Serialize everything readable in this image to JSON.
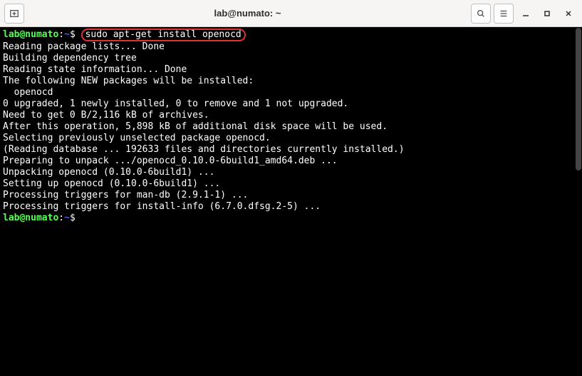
{
  "window": {
    "title": "lab@numato: ~"
  },
  "prompt1": {
    "user": "lab@numato",
    "sep": ":",
    "path": "~",
    "dollar": "$",
    "command": "sudo apt-get install openocd"
  },
  "output": {
    "l1": "Reading package lists... Done",
    "l2": "Building dependency tree",
    "l3": "Reading state information... Done",
    "l4": "The following NEW packages will be installed:",
    "l5": "  openocd",
    "l6": "0 upgraded, 1 newly installed, 0 to remove and 1 not upgraded.",
    "l7": "Need to get 0 B/2,116 kB of archives.",
    "l8": "After this operation, 5,898 kB of additional disk space will be used.",
    "l9": "Selecting previously unselected package openocd.",
    "l10": "(Reading database ... 192633 files and directories currently installed.)",
    "l11": "Preparing to unpack .../openocd_0.10.0-6build1_amd64.deb ...",
    "l12": "Unpacking openocd (0.10.0-6build1) ...",
    "l13": "Setting up openocd (0.10.0-6build1) ...",
    "l14": "Processing triggers for man-db (2.9.1-1) ...",
    "l15": "Processing triggers for install-info (6.7.0.dfsg.2-5) ..."
  },
  "prompt2": {
    "user": "lab@numato",
    "sep": ":",
    "path": "~",
    "dollar": "$"
  }
}
